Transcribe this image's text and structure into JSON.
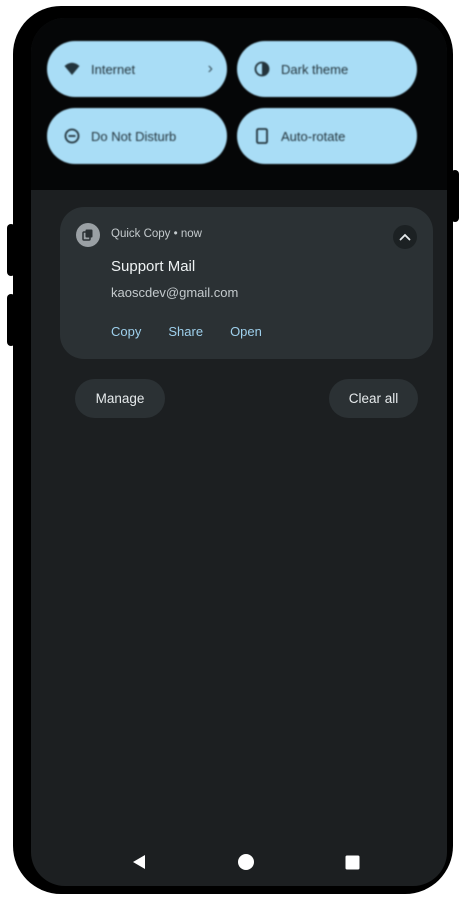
{
  "quick_settings": {
    "tiles": [
      {
        "label": "Internet",
        "icon": "wifi-icon",
        "has_chevron": true
      },
      {
        "label": "Dark theme",
        "icon": "half-circle-icon",
        "has_chevron": false
      },
      {
        "label": "Do Not Disturb",
        "icon": "do-not-disturb-icon",
        "has_chevron": false
      },
      {
        "label": "Auto-rotate",
        "icon": "phone-rotate-icon",
        "has_chevron": false
      }
    ],
    "tile_color": "#a9ddf6"
  },
  "notification": {
    "app_name": "Quick Copy",
    "separator": "•",
    "time": "now",
    "title": "Support Mail",
    "text": "kaoscdev@gmail.com",
    "actions": [
      "Copy",
      "Share",
      "Open"
    ],
    "action_color": "#9ed0ec"
  },
  "shade_buttons": {
    "manage": "Manage",
    "clear_all": "Clear all"
  },
  "nav_bar": {
    "back": "back-icon",
    "home": "home-icon",
    "recents": "recents-icon"
  },
  "colors": {
    "screen_bg": "#1c1f21",
    "card_bg": "#2b3134"
  }
}
